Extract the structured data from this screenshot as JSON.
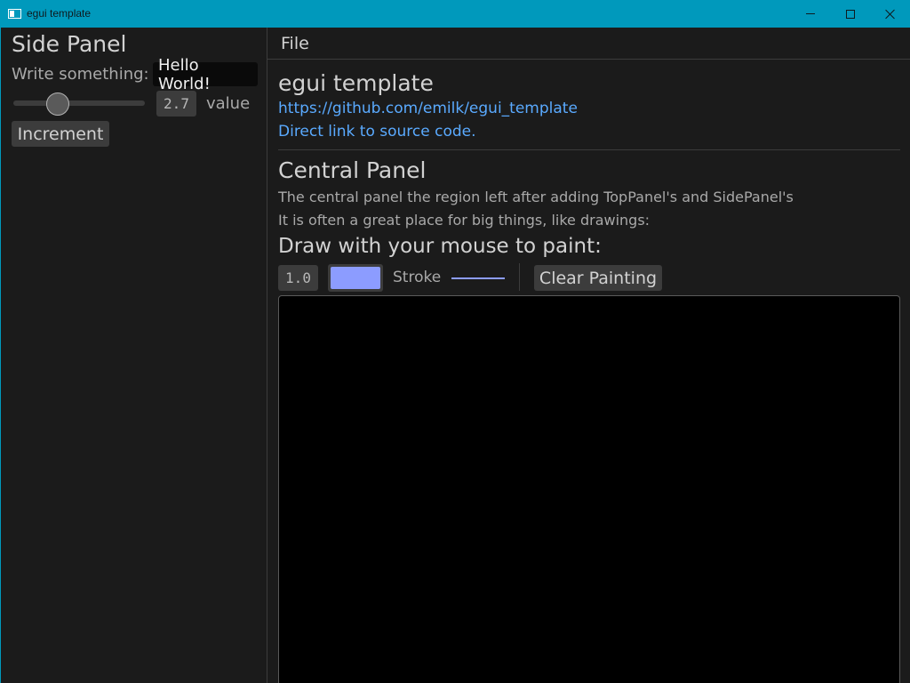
{
  "window": {
    "title": "egui template",
    "accent_color": "#0099bc"
  },
  "side_panel": {
    "title": "Side Panel",
    "write_label": "Write something:",
    "text_value": "Hello World!",
    "slider_value": "2.7",
    "slider_fraction": 0.3,
    "value_label": "value",
    "increment_label": "Increment"
  },
  "menu": {
    "file_label": "File"
  },
  "central": {
    "app_heading": "egui template",
    "repo_link": "https://github.com/emilk/egui_template",
    "source_link": "Direct link to source code.",
    "panel_heading": "Central Panel",
    "description_1": "The central panel the region left after adding TopPanel's and SidePanel's",
    "description_2": "It is often a great place for big things, like drawings:",
    "draw_heading": "Draw with your mouse to paint:",
    "stroke_width": "1.0",
    "stroke_color": "#8c9cff",
    "stroke_label": "Stroke",
    "clear_label": "Clear Painting"
  }
}
